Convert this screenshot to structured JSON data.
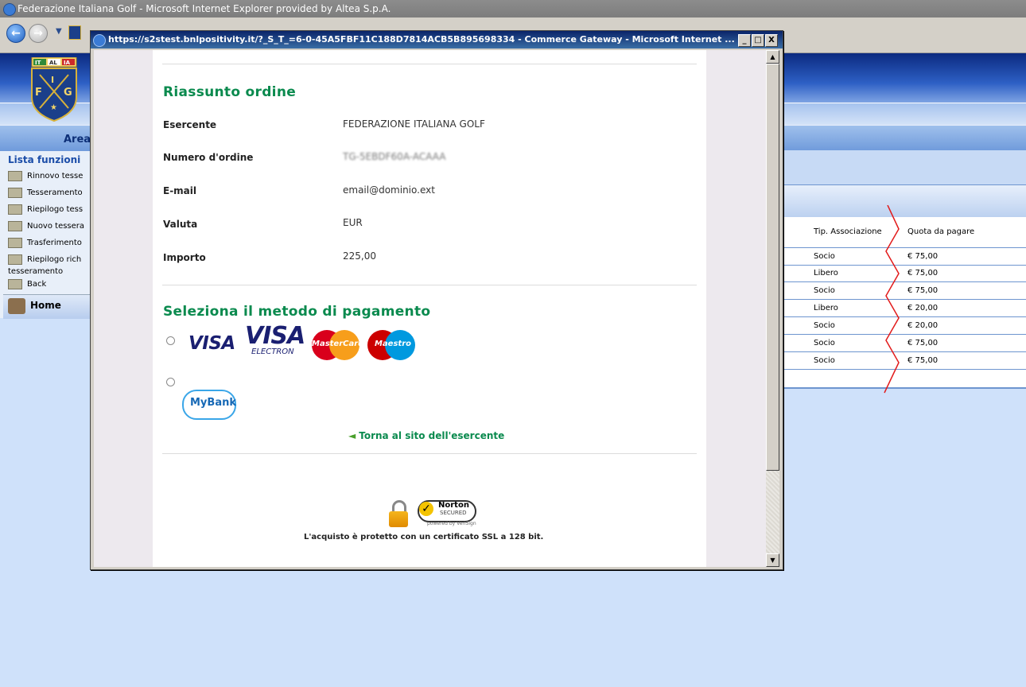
{
  "browser": {
    "window_title": "Federazione Italiana Golf - Microsoft Internet Explorer provided by Altea S.p.A."
  },
  "popup": {
    "window_title": "https://s2stest.bnlpositivity.it/?_S_T_=6-0-45A5FBF11C188D7814ACB5B895698334 - Commerce Gateway - Microsoft Internet ...",
    "minimize": "_",
    "maximize": "□",
    "close": "X",
    "order_summary": {
      "title": "Riassunto ordine",
      "fields": [
        {
          "label": "Esercente",
          "value": "FEDERAZIONE ITALIANA GOLF"
        },
        {
          "label": "Numero d'ordine",
          "value": "TG-5EBDF60A-ACAAA"
        },
        {
          "label": "E-mail",
          "value": "email@dominio.ext"
        },
        {
          "label": "Valuta",
          "value": "EUR"
        },
        {
          "label": "Importo",
          "value": "225,00"
        }
      ]
    },
    "payment": {
      "title": "Seleziona il metodo di pagamento",
      "card_logos": {
        "visa": "VISA",
        "visa_electron_top": "VISA",
        "visa_electron_bottom": "ELECTRON",
        "mastercard": "MasterCard",
        "maestro": "Maestro"
      },
      "mybank": "MyBank"
    },
    "back_link": "Torna al sito dell'esercente",
    "norton": {
      "brand": "Norton",
      "secured": "SECURED",
      "powered": "powered by VeriSign"
    },
    "ssl_text": "L'acquisto è protetto con un certificato SSL a 128 bit."
  },
  "site": {
    "logo": {
      "letters_top": [
        "IT",
        "AL",
        "IA"
      ],
      "letters": [
        "F",
        "I",
        "G"
      ]
    },
    "area_title": "Area di",
    "sidebar": {
      "title": "Lista funzioni",
      "items": [
        "Rinnovo tesse",
        "Tesseramento",
        "Riepilogo tess",
        "Nuovo tessera",
        "Trasferimento",
        "Riepilogo rich"
      ],
      "tesseramento": "tesseramento",
      "back": "Back",
      "home": "Home"
    },
    "table": {
      "headers": [
        "Tip. Associazione",
        "Quota da pagare"
      ],
      "rows": [
        [
          "Socio",
          "€ 75,00"
        ],
        [
          "Libero",
          "€ 75,00"
        ],
        [
          "Socio",
          "€ 75,00"
        ],
        [
          "Libero",
          "€ 20,00"
        ],
        [
          "Socio",
          "€ 20,00"
        ],
        [
          "Socio",
          "€ 75,00"
        ],
        [
          "Socio",
          "€ 75,00"
        ]
      ]
    }
  },
  "colors": {
    "accent_green": "#0a8a4e",
    "titlebar_blue": "#0a246a",
    "page_bg": "#cfe1fa"
  }
}
